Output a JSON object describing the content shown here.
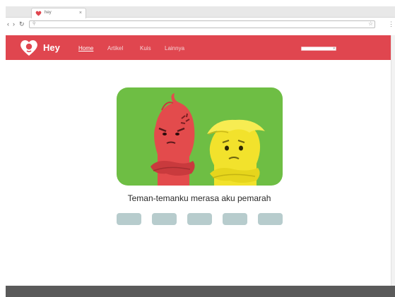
{
  "browser": {
    "tab_title": "hey",
    "tab_close": "×",
    "back": "‹",
    "forward": "›",
    "reload": "↻",
    "star": "☆",
    "menu": "⋮",
    "search_glyph": "⚲"
  },
  "header": {
    "brand": "Hey",
    "nav": [
      "Home",
      "Artikel",
      "Kuis",
      "Lainnya"
    ],
    "active_nav": "Home"
  },
  "main": {
    "caption": "Teman-temanku merasa aku pemarah",
    "option_count": 5
  },
  "colors": {
    "brand_red": "#e0464f",
    "hero_green": "#6ebe44",
    "option_button": "#b7cccd",
    "angry_character": "#e34b4c",
    "sad_character": "#f2e22c"
  }
}
